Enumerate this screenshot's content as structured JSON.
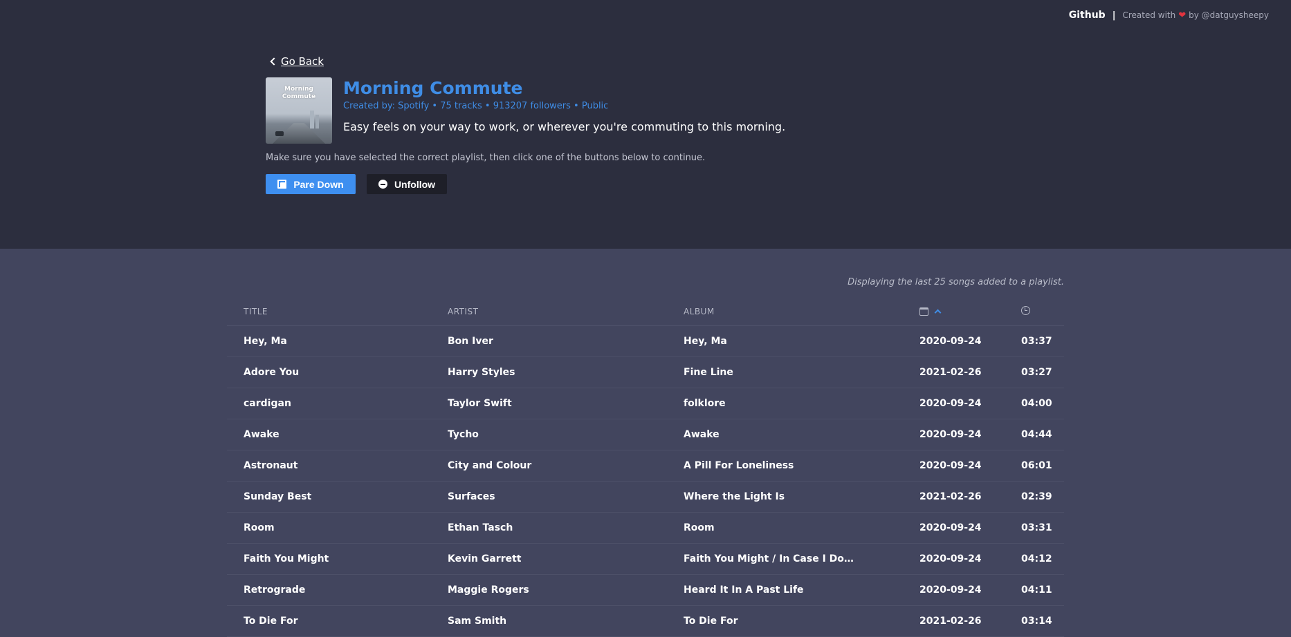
{
  "topbar": {
    "github_label": "Github",
    "separator": "|",
    "credit_prefix": "Created with",
    "credit_suffix": "by @datguysheepy"
  },
  "nav": {
    "go_back_label": "Go Back"
  },
  "playlist": {
    "cover_text_line1": "Morning",
    "cover_text_line2": "Commute",
    "title": "Morning Commute",
    "meta": "Created by: Spotify • 75 tracks • 913207 followers • Public",
    "description": "Easy feels on your way to work, or wherever you're commuting to this morning."
  },
  "instructions": "Make sure you have selected the correct playlist, then click one of the buttons below to continue.",
  "actions": {
    "pare_down_label": "Pare Down",
    "unfollow_label": "Unfollow"
  },
  "table": {
    "note": "Displaying the last 25 songs added to a playlist.",
    "headers": {
      "title": "TITLE",
      "artist": "ARTIST",
      "album": "ALBUM"
    },
    "rows": [
      {
        "title": "Hey, Ma",
        "artist": "Bon Iver",
        "album": "Hey, Ma",
        "date": "2020-09-24",
        "duration": "03:37"
      },
      {
        "title": "Adore You",
        "artist": "Harry Styles",
        "album": "Fine Line",
        "date": "2021-02-26",
        "duration": "03:27"
      },
      {
        "title": "cardigan",
        "artist": "Taylor Swift",
        "album": "folklore",
        "date": "2020-09-24",
        "duration": "04:00"
      },
      {
        "title": "Awake",
        "artist": "Tycho",
        "album": "Awake",
        "date": "2020-09-24",
        "duration": "04:44"
      },
      {
        "title": "Astronaut",
        "artist": "City and Colour",
        "album": "A Pill For Loneliness",
        "date": "2020-09-24",
        "duration": "06:01"
      },
      {
        "title": "Sunday Best",
        "artist": "Surfaces",
        "album": "Where the Light Is",
        "date": "2021-02-26",
        "duration": "02:39"
      },
      {
        "title": "Room",
        "artist": "Ethan Tasch",
        "album": "Room",
        "date": "2020-09-24",
        "duration": "03:31"
      },
      {
        "title": "Faith You Might",
        "artist": "Kevin Garrett",
        "album": "Faith You Might / In Case I Do…",
        "date": "2020-09-24",
        "duration": "04:12"
      },
      {
        "title": "Retrograde",
        "artist": "Maggie Rogers",
        "album": "Heard It In A Past Life",
        "date": "2020-09-24",
        "duration": "04:11"
      },
      {
        "title": "To Die For",
        "artist": "Sam Smith",
        "album": "To Die For",
        "date": "2021-02-26",
        "duration": "03:14"
      }
    ]
  },
  "colors": {
    "accent": "#3f8de6",
    "button_primary": "#3e8ff0",
    "button_dark": "#1e1f28",
    "header_bg": "#2c2e3e",
    "table_bg": "#42455e",
    "heart": "#e3343f"
  }
}
